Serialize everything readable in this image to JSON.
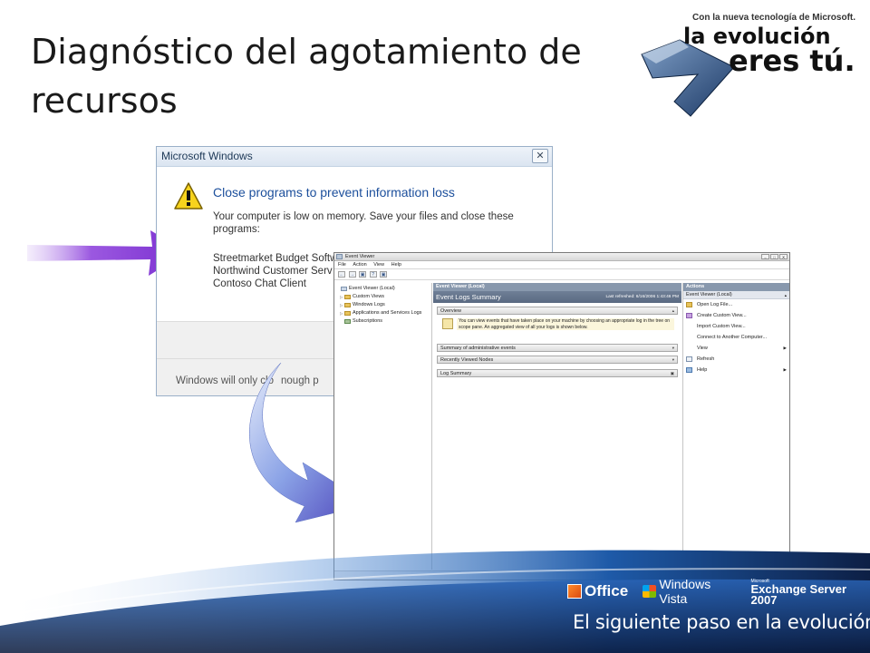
{
  "slide": {
    "title": "Diagnóstico del agotamiento de recursos"
  },
  "logo": {
    "tagline": "Con la nueva tecnología de Microsoft.",
    "line1": "la evolución",
    "line2": "eres tú."
  },
  "dialog": {
    "window_title": "Microsoft Windows",
    "close_glyph": "✕",
    "icon": "warning-icon",
    "heading": "Close programs to prevent information loss",
    "message": "Your computer is low on memory. Save your files and close these programs:",
    "programs": [
      "Streetmarket Budget Softw",
      "Northwind Customer Serv",
      "Contoso Chat Client"
    ],
    "footer_text": "Windows will only clo",
    "footer_text_tail": "nough p"
  },
  "event_viewer": {
    "window_title": "Event Viewer",
    "menu": [
      "File",
      "Action",
      "View",
      "Help"
    ],
    "toolbar": [
      "←",
      "→",
      "▣",
      "?",
      "▣"
    ],
    "tree": [
      {
        "label": "Event Viewer (Local)",
        "expander": ""
      },
      {
        "label": "Custom Views",
        "expander": "▷"
      },
      {
        "label": "Windows Logs",
        "expander": "▷"
      },
      {
        "label": "Applications and Services Logs",
        "expander": "▷"
      },
      {
        "label": "Subscriptions",
        "expander": ""
      }
    ],
    "center_header": "Event Viewer (Local)",
    "summary_title": "Event Logs Summary",
    "last_refreshed": "Last refreshed: 6/16/2006 1:43:46 PM",
    "sections": {
      "overview": "Overview",
      "overview_text": "You can view events that have taken place on your machine by choosing an appropriate log in the tree on scope pane. An aggregated view of all your logs is shown below.",
      "admin_events": "Summary of administrative events",
      "recent_nodes": "Recently Viewed Nodes",
      "log_summary": "Log Summary"
    },
    "actions_header": "Actions",
    "actions_group": "Event Viewer (Local)",
    "actions": [
      {
        "label": "Open Log File...",
        "icon": "open-folder-icon",
        "submenu": false
      },
      {
        "label": "Create Custom View...",
        "icon": "filter-icon",
        "submenu": false
      },
      {
        "label": "Import Custom View...",
        "icon": "",
        "submenu": false
      },
      {
        "label": "Connect to Another Computer...",
        "icon": "",
        "submenu": false
      },
      {
        "label": "View",
        "icon": "",
        "submenu": true
      },
      {
        "label": "Refresh",
        "icon": "refresh-icon",
        "submenu": false
      },
      {
        "label": "Help",
        "icon": "help-icon",
        "submenu": true
      }
    ]
  },
  "banner": {
    "office": "Office",
    "windows_vista": "Windows Vista",
    "exchange_small": "Microsoft",
    "exchange": "Exchange Server 2007",
    "tagline": "El siguiente paso en la evolución."
  },
  "colors": {
    "title_text": "#1a1a1a",
    "dialog_heading": "#1c4f9c",
    "banner_dark": "#0d1f45",
    "banner_mid": "#1e5aa8",
    "arrow_purple": "#8a3fd6",
    "arrow_blue": "#4a63c9"
  }
}
